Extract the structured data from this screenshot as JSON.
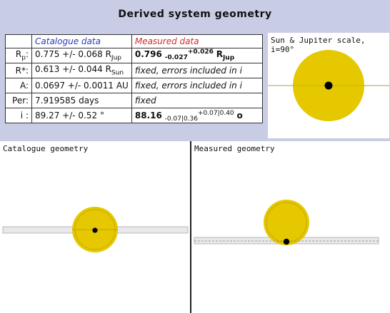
{
  "page": {
    "title": "Derived system geometry"
  },
  "table": {
    "header_catalogue": "Catalogue data",
    "header_measured": "Measured data",
    "rows": [
      {
        "label_main": "R",
        "label_sub": "p",
        "label_tail": ":",
        "catalogue_main": "0.775 +/- 0.068 R",
        "catalogue_sub": "Jup",
        "measured_value": "0.796",
        "measured_minus": "-0.027",
        "measured_plus": "+0.026",
        "measured_unit": "R",
        "measured_unit_sub": "Jup"
      },
      {
        "label_main": "R*:",
        "catalogue_main": "0.613 +/- 0.044 R",
        "catalogue_sub": "Sun",
        "measured_text": "fixed, errors included in i"
      },
      {
        "label_main": "A:",
        "catalogue_main": "0.0697 +/- 0.0011 AU",
        "measured_text": "fixed, errors included in i"
      },
      {
        "label_main": "Per:",
        "catalogue_main": "7.919585 days",
        "measured_text": "fixed"
      },
      {
        "label_main": "i :",
        "catalogue_main": "89.27 +/- 0.52 °",
        "measured_value": "88.16",
        "measured_minus": "-0.07|0.36",
        "measured_plus": "+0.07|0.40",
        "measured_unit": "o"
      }
    ]
  },
  "panels": {
    "scale_label": "Sun & Jupiter scale, i=90°",
    "catalogue_label": "Catalogue geometry",
    "measured_label": "Measured geometry"
  },
  "colors": {
    "star_fill": "#e5c800",
    "star_limb": "#c8a800",
    "planet": "#000000",
    "orbit_line": "#999999",
    "orbit_band": "#e8e8e8",
    "background": "#c8cce4"
  }
}
